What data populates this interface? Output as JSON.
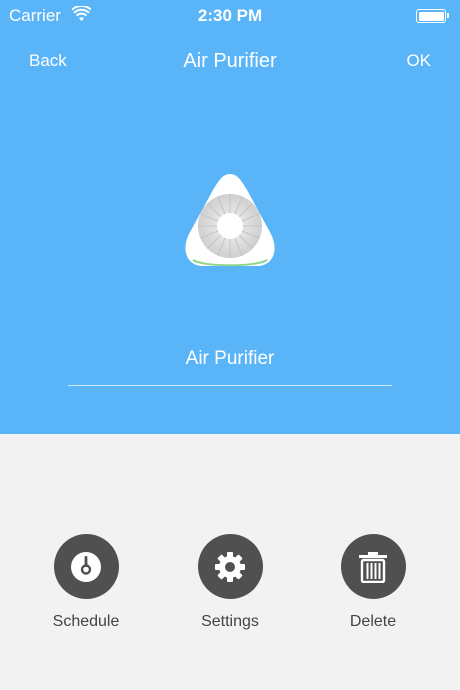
{
  "status_bar": {
    "carrier": "Carrier",
    "time": "2:30 PM",
    "wifi_icon": "wifi-icon",
    "battery_icon": "battery-icon"
  },
  "nav": {
    "back_label": "Back",
    "title": "Air Purifier",
    "ok_label": "OK"
  },
  "device": {
    "icon": "air-purifier-icon",
    "name_value": "Air Purifier"
  },
  "actions": [
    {
      "label": "Schedule",
      "icon": "clock-icon"
    },
    {
      "label": "Settings",
      "icon": "gear-icon"
    },
    {
      "label": "Delete",
      "icon": "trash-icon"
    }
  ],
  "colors": {
    "header_background": "#5ab4f8",
    "content_background": "#f2f2f2",
    "action_circle": "#505050",
    "action_label": "#444444"
  }
}
